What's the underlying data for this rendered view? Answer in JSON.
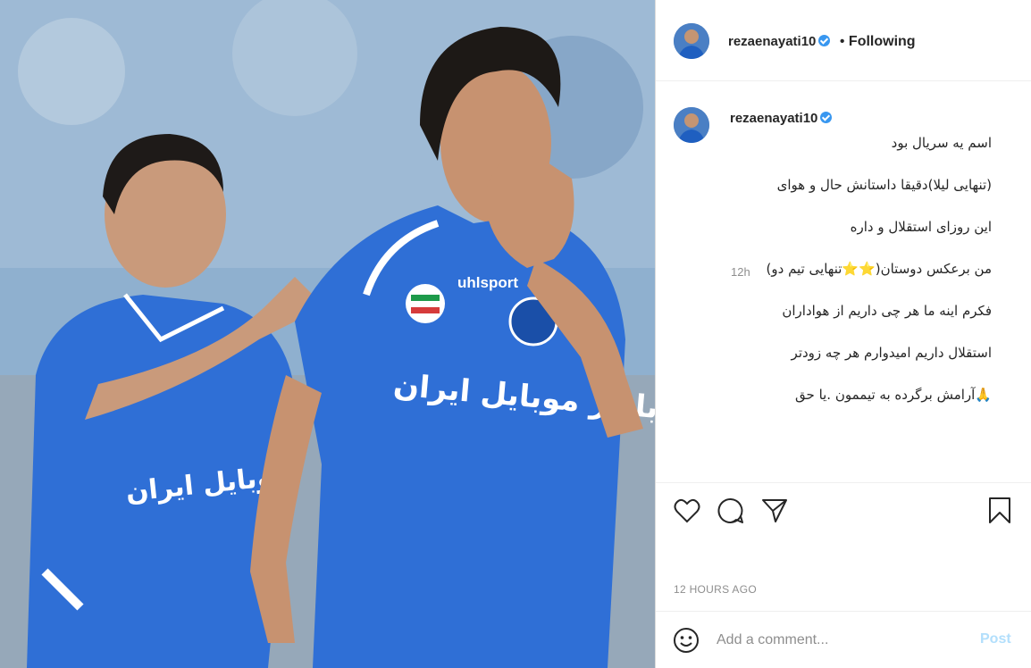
{
  "post": {
    "author": "rezaenayati10",
    "following_label": "Following",
    "dot": "•",
    "caption_lines": [
      "اسم یه سریال بود",
      "(تنهایی لیلا)دقیقا داستانش حال و هوای",
      "این روزای استقلال و داره",
      "من برعکس دوستان(⭐⭐تنهایی تیم دو)",
      "فکرم اینه ما هر چی داریم از هواداران",
      "استقلال داریم امیدوارم هر چه زودتر",
      "🙏آرامش برگرده به تیممون .یا حق"
    ],
    "caption_time": "12h",
    "date_label": "12 HOURS AGO",
    "comment_placeholder": "Add a comment...",
    "post_button": "Post"
  },
  "photo": {
    "jersey_text": "بازار موبایل ایران",
    "jersey_text_left": "موبایل ایران",
    "brand_text": "uhlsport"
  },
  "colors": {
    "jersey_blue": "#2f6fd6",
    "verified": "#3897f0",
    "post_disabled": "#b2dffc"
  },
  "icons": [
    "verified-badge-icon",
    "heart-icon",
    "comment-icon",
    "share-icon",
    "bookmark-icon",
    "emoji-icon"
  ]
}
